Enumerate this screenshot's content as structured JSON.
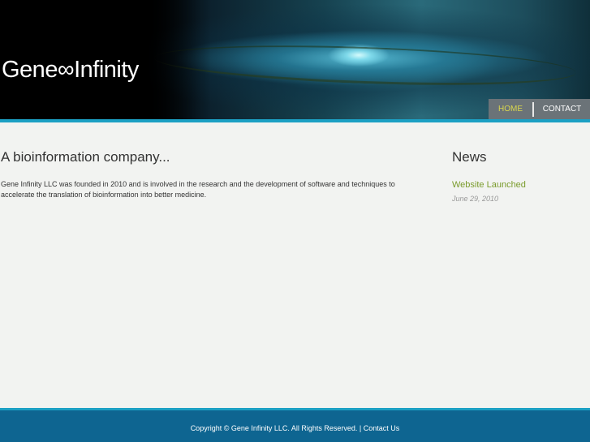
{
  "header": {
    "logo_text": "Gene∞Infinity",
    "nav": {
      "home": "HOME",
      "contact": "CONTACT"
    }
  },
  "main": {
    "title": "A bioinformation company...",
    "intro": "Gene Infinity LLC was founded in 2010 and is involved in the research and the development of software and techniques to accelerate the translation of bioinformation into better medicine."
  },
  "news": {
    "title": "News",
    "items": [
      {
        "headline": "Website Launched",
        "date": "June 29, 2010"
      }
    ]
  },
  "footer": {
    "copyright": "Copyright © Gene Infinity LLC. All Rights Reserved. |",
    "contact_link": "Contact Us"
  },
  "colors": {
    "accent_rule": "#1ca0c4",
    "footer_bg": "#0e6591",
    "nav_bg": "#6b7378",
    "nav_active": "#d9d64e",
    "news_link": "#7a9b2c"
  }
}
